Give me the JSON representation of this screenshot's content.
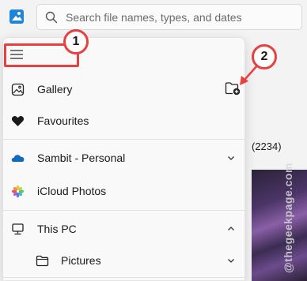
{
  "search": {
    "placeholder": "Search file names, types, and dates"
  },
  "nav": {
    "items": [
      {
        "label": "Gallery"
      },
      {
        "label": "Favourites"
      },
      {
        "label": "Sambit - Personal"
      },
      {
        "label": "iCloud Photos"
      },
      {
        "label": "This PC"
      },
      {
        "label": "Pictures"
      }
    ]
  },
  "background": {
    "count": "(2234)"
  },
  "annotations": {
    "step1": "1",
    "step2": "2"
  },
  "watermark": "@thegeekpage.com",
  "colors": {
    "annotation_red": "#e8403f",
    "onedrive_blue": "#0f6cbd",
    "accent": "#0067c0"
  }
}
